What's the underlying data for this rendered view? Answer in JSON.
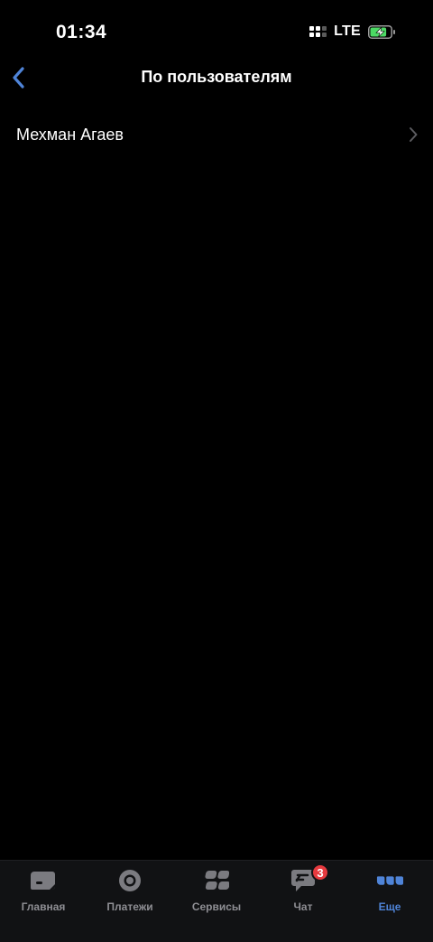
{
  "status_bar": {
    "time": "01:34",
    "network": "LTE",
    "battery_level": 0.8
  },
  "nav": {
    "title": "По пользователям",
    "back_icon": "chevron-left-icon"
  },
  "list": {
    "items": [
      {
        "label": "Мехман Агаев"
      }
    ]
  },
  "tab_bar": {
    "tabs": [
      {
        "label": "Главная",
        "icon": "home-card-icon",
        "active": false
      },
      {
        "label": "Платежи",
        "icon": "payments-circle-icon",
        "active": false
      },
      {
        "label": "Сервисы",
        "icon": "services-grid-icon",
        "active": false
      },
      {
        "label": "Чат",
        "icon": "chat-icon",
        "active": false,
        "badge": "3"
      },
      {
        "label": "Еще",
        "icon": "more-dots-icon",
        "active": true
      }
    ]
  },
  "colors": {
    "accent": "#4f84d8",
    "background": "#000000",
    "tab_bar_bg": "#111214",
    "badge": "#e63a3f",
    "battery_fill": "#4cd964",
    "inactive": "#8e8e93"
  }
}
